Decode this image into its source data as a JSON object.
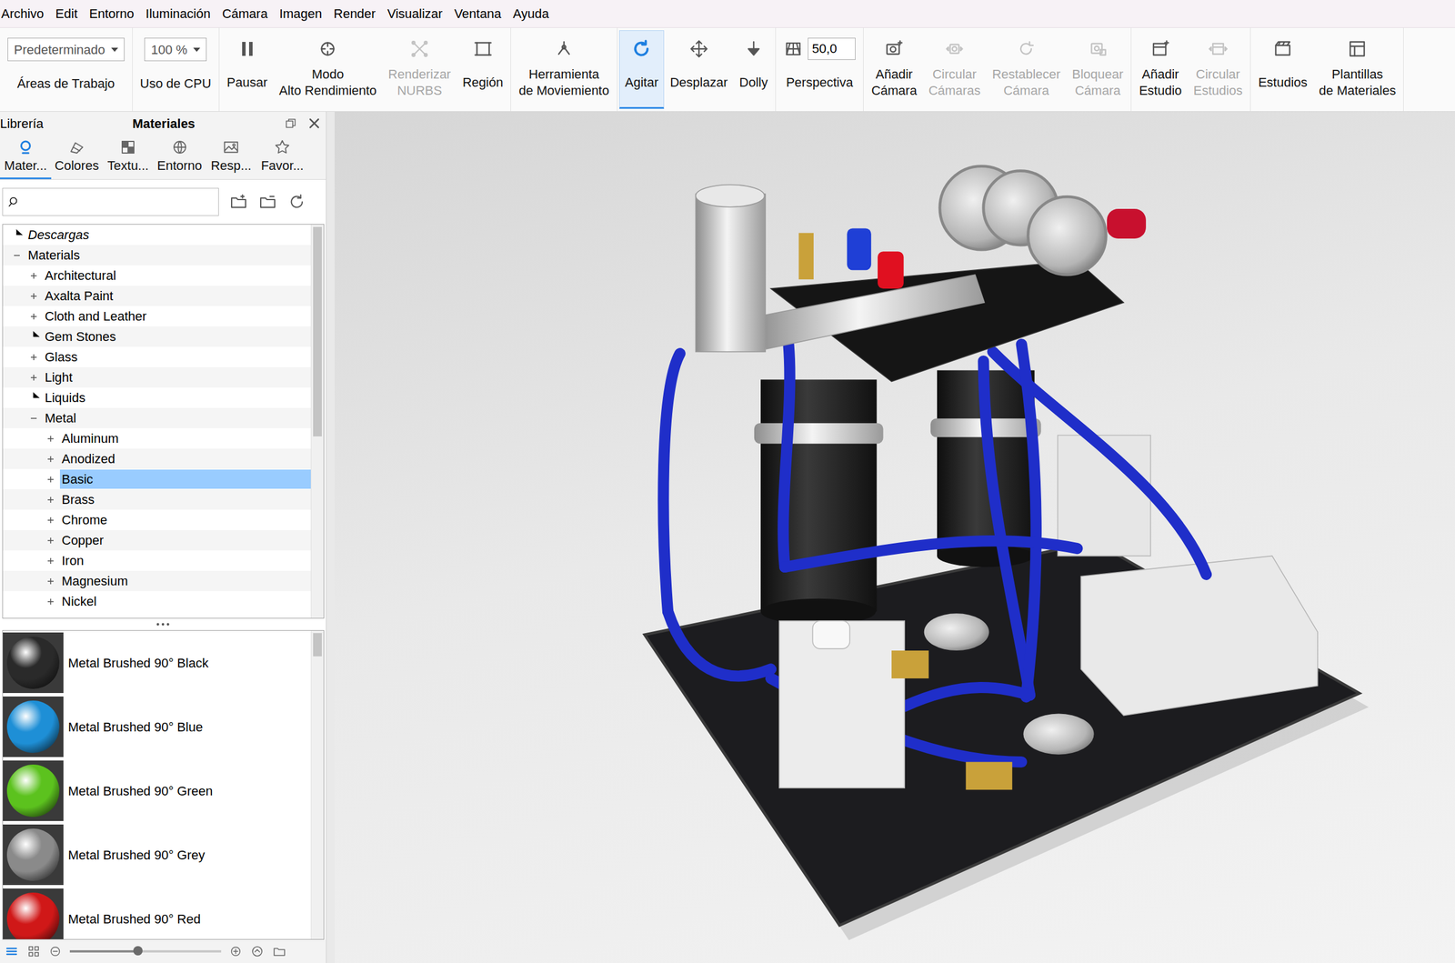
{
  "menu": [
    "Archivo",
    "Edit",
    "Entorno",
    "Iluminación",
    "Cámara",
    "Imagen",
    "Render",
    "Visualizar",
    "Ventana",
    "Ayuda"
  ],
  "toolbar": {
    "groups": [
      {
        "items": [
          {
            "kind": "dropdown",
            "value": "Predeterminado",
            "label": [
              "Áreas de Trabajo"
            ],
            "disabled": false,
            "selected": false
          }
        ]
      },
      {
        "items": [
          {
            "kind": "dropdown",
            "value": "100 %",
            "label": [
              "Uso de CPU"
            ],
            "disabled": false,
            "selected": false
          }
        ]
      },
      {
        "items": [
          {
            "kind": "button",
            "label": [
              "Pausar"
            ],
            "disabled": false,
            "selected": false
          },
          {
            "kind": "button",
            "label": [
              "Modo",
              "Alto Rendimiento"
            ],
            "disabled": false,
            "selected": false
          },
          {
            "kind": "button",
            "label": [
              "Renderizar",
              "NURBS"
            ],
            "disabled": true,
            "selected": false
          },
          {
            "kind": "button",
            "label": [
              "Región"
            ],
            "disabled": false,
            "selected": false
          }
        ]
      },
      {
        "items": [
          {
            "kind": "button",
            "label": [
              "Herramienta",
              "de Moviemiento"
            ],
            "disabled": false,
            "selected": false
          }
        ]
      },
      {
        "items": [
          {
            "kind": "button",
            "label": [
              "Agitar"
            ],
            "disabled": false,
            "selected": true
          },
          {
            "kind": "button",
            "label": [
              "Desplazar"
            ],
            "disabled": false,
            "selected": false
          },
          {
            "kind": "button",
            "label": [
              "Dolly"
            ],
            "disabled": false,
            "selected": false
          }
        ]
      },
      {
        "items": [
          {
            "kind": "field",
            "value": "50,0",
            "label": [
              "Perspectiva"
            ],
            "disabled": false,
            "selected": false
          }
        ]
      },
      {
        "items": [
          {
            "kind": "button",
            "label": [
              "Añadir",
              "Cámara"
            ],
            "disabled": false,
            "selected": false
          },
          {
            "kind": "button",
            "label": [
              "Circular",
              "Cámaras"
            ],
            "disabled": true,
            "selected": false
          },
          {
            "kind": "button",
            "label": [
              "Restablecer",
              "Cámara"
            ],
            "disabled": true,
            "selected": false
          },
          {
            "kind": "button",
            "label": [
              "Bloquear",
              "Cámara"
            ],
            "disabled": true,
            "selected": false
          }
        ]
      },
      {
        "items": [
          {
            "kind": "button",
            "label": [
              "Añadir",
              "Estudio"
            ],
            "disabled": false,
            "selected": false
          },
          {
            "kind": "button",
            "label": [
              "Circular",
              "Estudios"
            ],
            "disabled": true,
            "selected": false
          }
        ]
      },
      {
        "items": [
          {
            "kind": "button",
            "label": [
              "Estudios"
            ],
            "disabled": false,
            "selected": false
          },
          {
            "kind": "button",
            "label": [
              "Plantillas",
              "de Materiales"
            ],
            "disabled": false,
            "selected": false
          }
        ]
      }
    ]
  },
  "library": {
    "header": "Librería",
    "title": "Materiales",
    "tabs": [
      {
        "label": "Mater...",
        "selected": true
      },
      {
        "label": "Colores",
        "selected": false
      },
      {
        "label": "Textu...",
        "selected": false
      },
      {
        "label": "Entorno",
        "selected": false
      },
      {
        "label": "Resp...",
        "selected": false
      },
      {
        "label": "Favor...",
        "selected": false
      }
    ],
    "tree": [
      {
        "label": "Descargas",
        "level": 0,
        "expandable": false,
        "expanded": false,
        "selected": false,
        "italic": true
      },
      {
        "label": "Materials",
        "level": 0,
        "expandable": true,
        "expanded": true,
        "selected": false,
        "italic": false
      },
      {
        "label": "Architectural",
        "level": 1,
        "expandable": true,
        "expanded": false,
        "selected": false,
        "italic": false
      },
      {
        "label": "Axalta Paint",
        "level": 1,
        "expandable": true,
        "expanded": false,
        "selected": false,
        "italic": false
      },
      {
        "label": "Cloth and Leather",
        "level": 1,
        "expandable": true,
        "expanded": false,
        "selected": false,
        "italic": false
      },
      {
        "label": "Gem Stones",
        "level": 1,
        "expandable": false,
        "expanded": false,
        "selected": false,
        "italic": false
      },
      {
        "label": "Glass",
        "level": 1,
        "expandable": true,
        "expanded": false,
        "selected": false,
        "italic": false
      },
      {
        "label": "Light",
        "level": 1,
        "expandable": true,
        "expanded": false,
        "selected": false,
        "italic": false
      },
      {
        "label": "Liquids",
        "level": 1,
        "expandable": false,
        "expanded": false,
        "selected": false,
        "italic": false
      },
      {
        "label": "Metal",
        "level": 1,
        "expandable": true,
        "expanded": true,
        "selected": false,
        "italic": false
      },
      {
        "label": "Aluminum",
        "level": 2,
        "expandable": true,
        "expanded": false,
        "selected": false,
        "italic": false
      },
      {
        "label": "Anodized",
        "level": 2,
        "expandable": true,
        "expanded": false,
        "selected": false,
        "italic": false
      },
      {
        "label": "Basic",
        "level": 2,
        "expandable": true,
        "expanded": false,
        "selected": true,
        "italic": false
      },
      {
        "label": "Brass",
        "level": 2,
        "expandable": true,
        "expanded": false,
        "selected": false,
        "italic": false
      },
      {
        "label": "Chrome",
        "level": 2,
        "expandable": true,
        "expanded": false,
        "selected": false,
        "italic": false
      },
      {
        "label": "Copper",
        "level": 2,
        "expandable": true,
        "expanded": false,
        "selected": false,
        "italic": false
      },
      {
        "label": "Iron",
        "level": 2,
        "expandable": true,
        "expanded": false,
        "selected": false,
        "italic": false
      },
      {
        "label": "Magnesium",
        "level": 2,
        "expandable": true,
        "expanded": false,
        "selected": false,
        "italic": false
      },
      {
        "label": "Nickel",
        "level": 2,
        "expandable": true,
        "expanded": false,
        "selected": false,
        "italic": false
      }
    ],
    "materials": [
      {
        "name": "Metal Brushed 90° Black",
        "color": "#2a2a2a"
      },
      {
        "name": "Metal Brushed 90° Blue",
        "color": "#1e8fd6"
      },
      {
        "name": "Metal Brushed 90° Green",
        "color": "#5cc21e"
      },
      {
        "name": "Metal Brushed 90° Grey",
        "color": "#8a8a8a"
      },
      {
        "name": "Metal Brushed 90° Red",
        "color": "#d01818"
      }
    ],
    "zoom": {
      "level": 0.45
    }
  }
}
